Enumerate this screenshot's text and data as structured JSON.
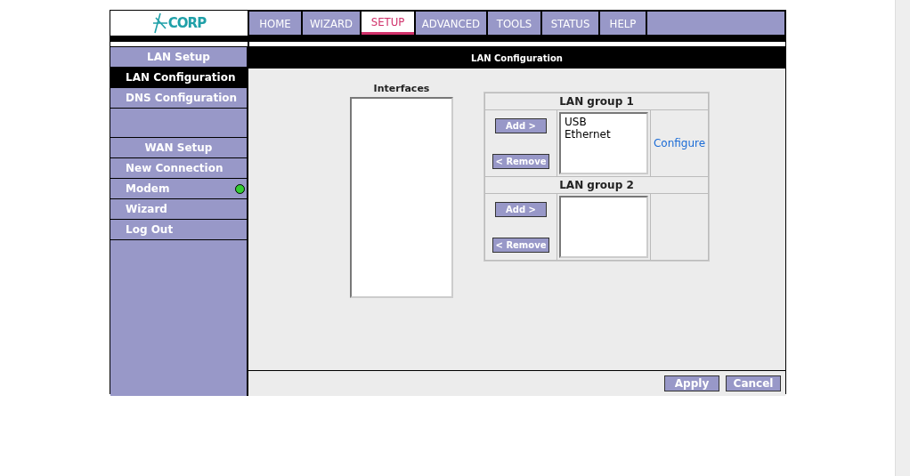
{
  "logo": {
    "text": "CORP"
  },
  "tabs": [
    {
      "label": "HOME",
      "selected": false
    },
    {
      "label": "WIZARD",
      "selected": false
    },
    {
      "label": "SETUP",
      "selected": true
    },
    {
      "label": "ADVANCED",
      "selected": false
    },
    {
      "label": "TOOLS",
      "selected": false
    },
    {
      "label": "STATUS",
      "selected": false
    },
    {
      "label": "HELP",
      "selected": false
    }
  ],
  "sidebar": {
    "sections": [
      {
        "title": "LAN Setup",
        "items": [
          {
            "label": "LAN Configuration",
            "selected": true
          },
          {
            "label": "DNS Configuration",
            "selected": false
          }
        ]
      },
      {
        "title": "WAN Setup",
        "items": [
          {
            "label": "New Connection",
            "selected": false
          },
          {
            "label": "Modem",
            "selected": false,
            "color": "#33cc33"
          },
          {
            "label": "Wizard",
            "selected": false
          },
          {
            "label": "Log Out",
            "selected": false
          }
        ]
      }
    ]
  },
  "page_title": "LAN Configuration",
  "interfaces": {
    "label": "Interfaces"
  },
  "lan_groups": [
    {
      "title": "LAN group 1",
      "add_button": "Add >",
      "remove_button": "< Remove",
      "members": [
        "USB",
        "Ethernet"
      ],
      "link": "Configure"
    },
    {
      "title": "LAN group 2",
      "add_button": "Add >",
      "remove_button": "< Remove"
    }
  ],
  "buttons": [
    "Apply",
    "Cancel"
  ]
}
